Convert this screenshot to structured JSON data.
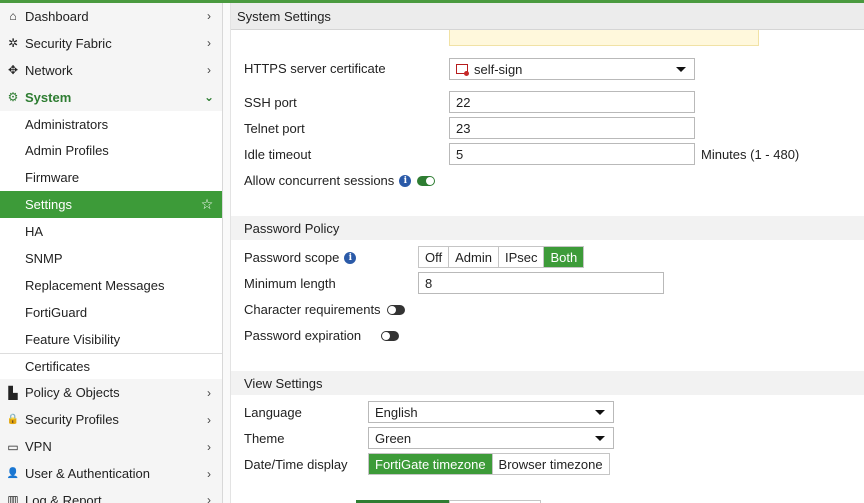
{
  "sidebar": {
    "items": [
      {
        "label": "Dashboard",
        "icon": "dashboard-icon",
        "glyph": "⌂",
        "chevron": "›"
      },
      {
        "label": "Security Fabric",
        "icon": "security-fabric-icon",
        "glyph": "✲",
        "chevron": "›"
      },
      {
        "label": "Network",
        "icon": "network-icon",
        "glyph": "✥",
        "chevron": "›"
      },
      {
        "label": "System",
        "icon": "gear-icon",
        "glyph": "⚙",
        "chevron": "⌄"
      },
      {
        "label": "Administrators"
      },
      {
        "label": "Admin Profiles"
      },
      {
        "label": "Firmware"
      },
      {
        "label": "Settings",
        "star": "☆"
      },
      {
        "label": "HA"
      },
      {
        "label": "SNMP"
      },
      {
        "label": "Replacement Messages"
      },
      {
        "label": "FortiGuard"
      },
      {
        "label": "Feature Visibility"
      },
      {
        "label": "Certificates"
      },
      {
        "label": "Policy & Objects",
        "icon": "policy-icon",
        "glyph": "▙",
        "chevron": "›"
      },
      {
        "label": "Security Profiles",
        "icon": "lock-icon",
        "glyph": "🔒",
        "chevron": "›"
      },
      {
        "label": "VPN",
        "icon": "laptop-icon",
        "glyph": "▭",
        "chevron": "›"
      },
      {
        "label": "User & Authentication",
        "icon": "user-icon",
        "glyph": "👤",
        "chevron": "›"
      },
      {
        "label": "Log & Report",
        "icon": "log-icon",
        "glyph": "▥",
        "chevron": "›"
      }
    ]
  },
  "header": {
    "title": "System Settings"
  },
  "form": {
    "https_cert_label": "HTTPS server certificate",
    "https_cert_value": "self-sign",
    "ssh_port_label": "SSH port",
    "ssh_port_value": "22",
    "telnet_port_label": "Telnet port",
    "telnet_port_value": "23",
    "idle_timeout_label": "Idle timeout",
    "idle_timeout_value": "5",
    "idle_timeout_unit": "Minutes (1 - 480)",
    "concurrent_label": "Allow concurrent sessions",
    "concurrent_on": true
  },
  "password_policy": {
    "title": "Password Policy",
    "scope_label": "Password scope",
    "scope_options": [
      "Off",
      "Admin",
      "IPsec",
      "Both"
    ],
    "scope_selected": "Both",
    "min_length_label": "Minimum length",
    "min_length_value": "8",
    "char_req_label": "Character requirements",
    "char_req_on": false,
    "expiration_label": "Password expiration",
    "expiration_on": false
  },
  "view_settings": {
    "title": "View Settings",
    "language_label": "Language",
    "language_value": "English",
    "theme_label": "Theme",
    "theme_value": "Green",
    "datetime_label": "Date/Time display",
    "datetime_options": [
      "FortiGate timezone",
      "Browser timezone"
    ],
    "datetime_selected": "FortiGate timezone"
  },
  "colors": {
    "accent": "#3d9b39",
    "info": "#2b5aa8"
  }
}
